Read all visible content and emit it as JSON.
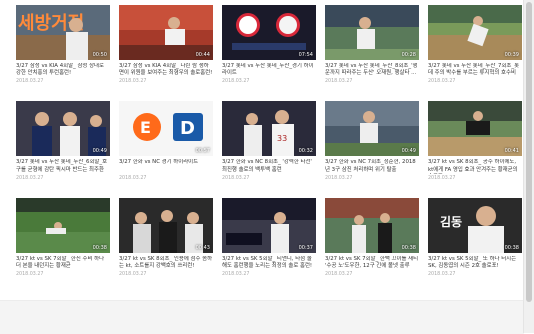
{
  "videos": [
    {
      "title": "3/27 삼성 vs KIA 4회말_ 삼성 상대로 강한 안치홍의 투런홈런!",
      "date": "2018.03.27",
      "duration": "00:50"
    },
    {
      "title": "3/27 삼성 vs KIA 4회말_ 다린 람 챙하면이 위원을 보여주는 최형우의 솔로홈런!",
      "date": "2018.03.27",
      "duration": "00:44"
    },
    {
      "title": "3/27 롯데 vs 두산 롯데_두산_경기 하이라이트",
      "date": "2018.03.27",
      "duration": "07:54"
    },
    {
      "title": "3/27 롯데 vs 두산 롯데_두산_8회초_'행운까지 따라주는 두산' 오재원, 행살타 ...",
      "date": "2018.03.27",
      "duration": "00:28"
    },
    {
      "title": "3/27 롯데 vs 두산 롯데_두산_7회초_롯데 주의 박수를 부르는 류지혁의 호수비",
      "date": "2018.03.27",
      "duration": "00:39"
    },
    {
      "title": "3/27 롯데 vs 두산 롯데_두산_6회말_호구를 균형에 감탄 픽시마 반드는 최주환",
      "date": "2018.03.27",
      "duration": "00:49"
    },
    {
      "title": "3/27 한화 vs NC 경기 하이라이트",
      "date": "2018.03.27",
      "duration": "00:57"
    },
    {
      "title": "3/27 한화 vs NC 8회초_ '강력한 타선' 최진행 솔로의 백투백 홈런",
      "date": "2018.03.27",
      "duration": "00:32"
    },
    {
      "title": "3/27 한화 vs NC 7회초_정준현, 2018년 3구 삼진 처리하며 위기 탈출",
      "date": "2018.03.27",
      "duration": "00:49"
    },
    {
      "title": "3/27 kt vs SK 8회초_ 공수 하이에도, kt에게 FA 영입 효과 안겨주는 황재균의 솔로포",
      "date": "2018.03.27",
      "duration": "00:41"
    },
    {
      "title": "3/27 kt vs SK 7회말_ 한진 수비 하나 더 본을 내던지는 황재균",
      "date": "2018.03.27",
      "duration": "00:38"
    },
    {
      "title": "3/27 kt vs SK 8회초_ 인용에 점수 좀하는 kt, 소트를지 강백호의 쓰리런!",
      "date": "2018.03.27",
      "duration": "00:43"
    },
    {
      "title": "3/27 kt vs SK 5회말_ 티앤디, 타점 올해도 홈런행을 노리는 최정의 솔로 홈런!",
      "date": "2018.03.27",
      "duration": "00:37"
    },
    {
      "title": "3/27 kt vs SK 7회말_ 한백 끄이를 새티 '수공 노'도우한, 12구 긴에 볼넷 출루",
      "date": "2018.03.27",
      "duration": "00:38"
    },
    {
      "title": "3/27 kt vs SK 5회말_ 또 하나 터지는 SK, 김동엽의 시즌 2호 솔로포!",
      "date": "2018.03.27",
      "duration": "00:38"
    }
  ]
}
